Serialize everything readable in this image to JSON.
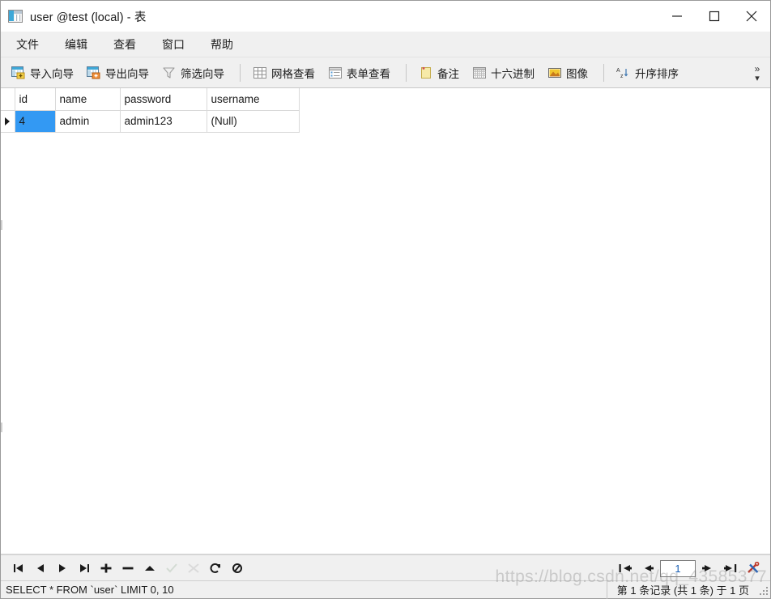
{
  "window": {
    "title": "user @test (local) - 表",
    "icon": "table-icon",
    "controls": [
      {
        "name": "minimize-button",
        "glyph": "minimize-icon"
      },
      {
        "name": "maximize-button",
        "glyph": "maximize-icon"
      },
      {
        "name": "close-button",
        "glyph": "close-icon"
      }
    ]
  },
  "menubar": {
    "items": [
      {
        "label": "文件"
      },
      {
        "label": "编辑"
      },
      {
        "label": "查看"
      },
      {
        "label": "窗口"
      },
      {
        "label": "帮助"
      }
    ]
  },
  "toolbar": {
    "groups": [
      {
        "items": [
          {
            "label": "导入向导",
            "icon": "import-wizard-icon"
          },
          {
            "label": "导出向导",
            "icon": "export-wizard-icon"
          },
          {
            "label": "筛选向导",
            "icon": "filter-funnel-icon"
          }
        ]
      },
      {
        "items": [
          {
            "label": "网格查看",
            "icon": "grid-view-icon"
          },
          {
            "label": "表单查看",
            "icon": "form-view-icon"
          }
        ]
      },
      {
        "items": [
          {
            "label": "备注",
            "icon": "note-icon"
          },
          {
            "label": "十六进制",
            "icon": "hex-icon"
          },
          {
            "label": "图像",
            "icon": "image-icon"
          }
        ]
      },
      {
        "items": [
          {
            "label": "升序排序",
            "icon": "sort-ascending-icon"
          }
        ]
      }
    ],
    "overflow_label": "»"
  },
  "grid": {
    "columns": [
      {
        "key": "id",
        "label": "id",
        "selected": true
      },
      {
        "key": "name",
        "label": "name",
        "selected": false
      },
      {
        "key": "password",
        "label": "password",
        "selected": false
      },
      {
        "key": "username",
        "label": "username",
        "selected": false
      }
    ],
    "rows": [
      {
        "current": true,
        "cells": [
          {
            "value": "4",
            "selected": true,
            "null": false
          },
          {
            "value": "admin",
            "selected": false,
            "null": false
          },
          {
            "value": "admin123",
            "selected": false,
            "null": false
          },
          {
            "value": "(Null)",
            "selected": false,
            "null": true
          }
        ]
      }
    ]
  },
  "navbar": {
    "buttons": [
      {
        "name": "first-record-button",
        "icon": "first-record-icon",
        "disabled": false
      },
      {
        "name": "previous-record-button",
        "icon": "previous-record-icon",
        "disabled": false
      },
      {
        "name": "next-record-button",
        "icon": "next-record-icon",
        "disabled": false
      },
      {
        "name": "last-record-button",
        "icon": "last-record-icon",
        "disabled": false
      },
      {
        "name": "add-record-button",
        "icon": "plus-icon",
        "disabled": false
      },
      {
        "name": "delete-record-button",
        "icon": "minus-icon",
        "disabled": false
      },
      {
        "name": "apply-change-button",
        "icon": "triangle-up-icon",
        "disabled": false
      },
      {
        "name": "confirm-button",
        "icon": "checkmark-icon",
        "disabled": true
      },
      {
        "name": "cancel-button",
        "icon": "cancel-x-icon",
        "disabled": true
      },
      {
        "name": "refresh-button",
        "icon": "refresh-icon",
        "disabled": false
      },
      {
        "name": "set-null-button",
        "icon": "null-slash-icon",
        "disabled": false
      }
    ]
  },
  "pager": {
    "first_page_icon": "first-page-icon",
    "previous_page_icon": "previous-page-icon",
    "page_value": "1",
    "page_placeholder": "1",
    "next_page_icon": "next-page-icon",
    "last_page_icon": "last-page-icon",
    "tools_icon": "tools-icon"
  },
  "statusbar": {
    "sql": "SELECT * FROM `user` LIMIT 0, 10",
    "record_info": "第 1 条记录 (共 1 条) 于 1 页",
    "resize_grip": "resize-grip-icon"
  },
  "watermark": {
    "text": "https://blog.csdn.net/qq_43585377"
  },
  "colors": {
    "accent_blue": "#3399f3",
    "selected_header": "#ddeaf7",
    "chrome": "#f0f0f0",
    "null_text": "#b5b5b5"
  }
}
